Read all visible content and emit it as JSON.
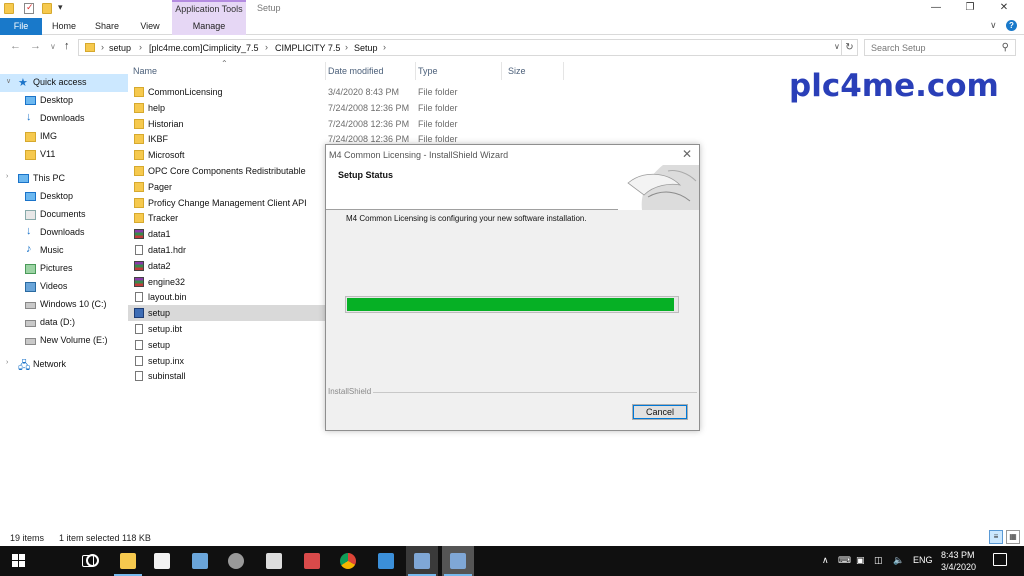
{
  "titlebar": {
    "contextual_tab": "Application Tools",
    "window_title": "Setup",
    "minimize": "—",
    "restore": "❐",
    "close": "✕",
    "qat_dropdown": "▾"
  },
  "ribbon": {
    "tabs": [
      "File",
      "Home",
      "Share",
      "View",
      "Manage"
    ],
    "help": "?",
    "expand": "∨"
  },
  "address": {
    "crumbs": [
      "setup",
      "[plc4me.com]Cimplicity_7.5",
      "CIMPLICITY 7.5",
      "Setup"
    ],
    "search_placeholder": "Search Setup"
  },
  "nav": {
    "items": [
      {
        "label": "Quick access",
        "icon": "star-icon"
      },
      {
        "label": "Desktop",
        "icon": "desktop-icon"
      },
      {
        "label": "Downloads",
        "icon": "downloads-icon"
      },
      {
        "label": "IMG",
        "icon": "folder-icon"
      },
      {
        "label": "V11",
        "icon": "folder-icon"
      },
      {
        "label": "This PC",
        "icon": "pc-icon"
      },
      {
        "label": "Desktop",
        "icon": "desktop-icon"
      },
      {
        "label": "Documents",
        "icon": "documents-icon"
      },
      {
        "label": "Downloads",
        "icon": "downloads-icon"
      },
      {
        "label": "Music",
        "icon": "music-icon"
      },
      {
        "label": "Pictures",
        "icon": "pictures-icon"
      },
      {
        "label": "Videos",
        "icon": "videos-icon"
      },
      {
        "label": "Windows 10 (C:)",
        "icon": "drive-icon"
      },
      {
        "label": "data (D:)",
        "icon": "drive-icon"
      },
      {
        "label": "New Volume (E:)",
        "icon": "drive-icon"
      },
      {
        "label": "Network",
        "icon": "network-icon"
      }
    ]
  },
  "columns": [
    "Name",
    "Date modified",
    "Type",
    "Size"
  ],
  "files": [
    {
      "name": "CommonLicensing",
      "date": "3/4/2020 8:43 PM",
      "type": "File folder",
      "icon": "folder-icon"
    },
    {
      "name": "help",
      "date": "7/24/2008 12:36 PM",
      "type": "File folder",
      "icon": "folder-icon"
    },
    {
      "name": "Historian",
      "date": "7/24/2008 12:36 PM",
      "type": "File folder",
      "icon": "folder-icon"
    },
    {
      "name": "IKBF",
      "date": "7/24/2008 12:36 PM",
      "type": "File folder",
      "icon": "folder-icon"
    },
    {
      "name": "Microsoft",
      "date": "",
      "type": "",
      "icon": "folder-icon"
    },
    {
      "name": "OPC Core Components Redistributable",
      "date": "",
      "type": "",
      "icon": "folder-icon"
    },
    {
      "name": "Pager",
      "date": "",
      "type": "",
      "icon": "folder-icon"
    },
    {
      "name": "Proficy Change Management Client API",
      "date": "",
      "type": "",
      "icon": "folder-icon"
    },
    {
      "name": "Tracker",
      "date": "",
      "type": "",
      "icon": "folder-icon"
    },
    {
      "name": "data1",
      "date": "",
      "type": "",
      "icon": "archive-icon"
    },
    {
      "name": "data1.hdr",
      "date": "",
      "type": "",
      "icon": "file-icon"
    },
    {
      "name": "data2",
      "date": "",
      "type": "",
      "icon": "archive-icon"
    },
    {
      "name": "engine32",
      "date": "",
      "type": "",
      "icon": "archive-icon"
    },
    {
      "name": "layout.bin",
      "date": "",
      "type": "",
      "icon": "file-icon"
    },
    {
      "name": "setup",
      "date": "",
      "type": "",
      "icon": "setup-icon",
      "selected": true
    },
    {
      "name": "setup.ibt",
      "date": "",
      "type": "",
      "icon": "file-icon"
    },
    {
      "name": "setup",
      "date": "",
      "type": "",
      "icon": "settings-file-icon"
    },
    {
      "name": "setup.inx",
      "date": "",
      "type": "",
      "icon": "file-icon"
    },
    {
      "name": "subinstall",
      "date": "",
      "type": "",
      "icon": "installer-icon"
    }
  ],
  "watermark": "plc4me.com",
  "dialog": {
    "title": "M4 Common Licensing - InstallShield Wizard",
    "heading": "Setup Status",
    "message": "M4 Common Licensing is configuring your new software installation.",
    "progress": 0.99,
    "brand": "InstallShield",
    "cancel": "Cancel",
    "close": "✕"
  },
  "status": {
    "items": "19 items",
    "selected": "1 item selected  118 KB"
  },
  "taskbar": {
    "tray": {
      "chevron": "∧",
      "lang": "ENG"
    },
    "time": "8:43 PM",
    "date": "3/4/2020"
  },
  "colors": {
    "accent": "#1979ca",
    "progress": "#06b025",
    "watermark": "#2a3fb8",
    "contextual_tab": "#e6d7f5"
  }
}
